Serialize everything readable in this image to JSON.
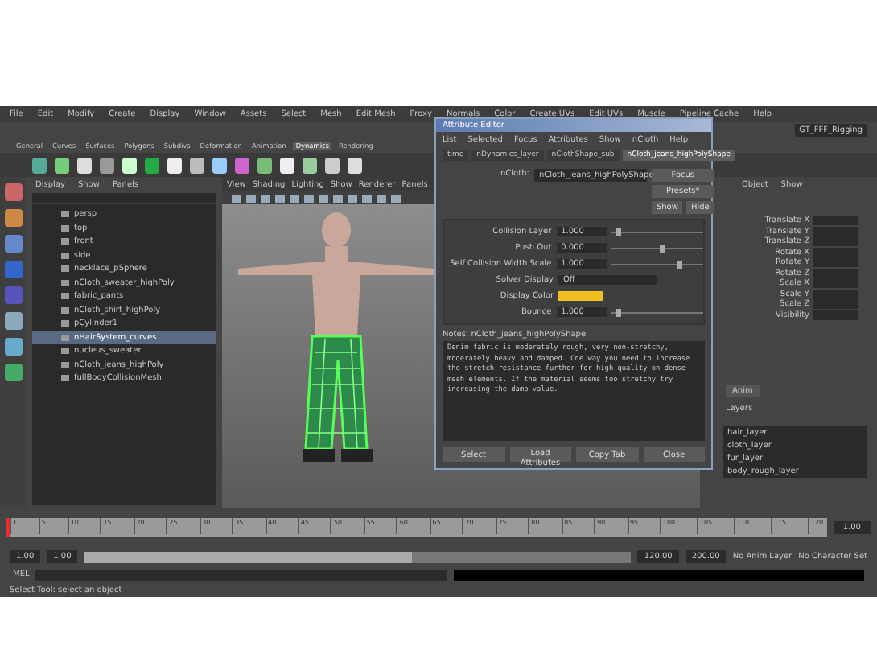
{
  "window": {
    "menus": [
      "File",
      "Edit",
      "Modify",
      "Create",
      "Display",
      "Window",
      "Assets",
      "Select",
      "Mesh",
      "Edit Mesh",
      "Proxy",
      "Normals",
      "Color",
      "Create UVs",
      "Edit UVs",
      "Muscle",
      "Pipeline Cache",
      "Help"
    ],
    "workspace": "GT_FFF_Rigging"
  },
  "shelf": {
    "tabs": [
      {
        "label": "General",
        "selected": false
      },
      {
        "label": "Curves",
        "selected": false
      },
      {
        "label": "Surfaces",
        "selected": false
      },
      {
        "label": "Polygons",
        "selected": false
      },
      {
        "label": "Subdivs",
        "selected": false
      },
      {
        "label": "Deformation",
        "selected": false
      },
      {
        "label": "Animation",
        "selected": false
      },
      {
        "label": "Dynamics",
        "selected": true
      },
      {
        "label": "Rendering",
        "selected": false
      }
    ]
  },
  "outliner": {
    "menus": [
      "Display",
      "Show",
      "Panels"
    ],
    "items": [
      {
        "label": "persp",
        "selected": false
      },
      {
        "label": "top",
        "selected": false
      },
      {
        "label": "front",
        "selected": false
      },
      {
        "label": "side",
        "selected": false
      },
      {
        "label": "necklace_pSphere",
        "selected": false
      },
      {
        "label": "nCloth_sweater_highPoly",
        "selected": false
      },
      {
        "label": "fabric_pants",
        "selected": false
      },
      {
        "label": "nCloth_shirt_highPoly",
        "selected": false
      },
      {
        "label": "pCylinder1",
        "selected": false
      },
      {
        "label": "nHairSystem_curves",
        "selected": true
      },
      {
        "label": "nucleus_sweater",
        "selected": false
      },
      {
        "label": "nCloth_jeans_highPoly",
        "selected": false
      },
      {
        "label": "fullBodyCollisionMesh",
        "selected": false
      }
    ]
  },
  "viewport": {
    "menus": [
      "View",
      "Shading",
      "Lighting",
      "Show",
      "Renderer",
      "Panels"
    ]
  },
  "attribute_editor": {
    "title": "Attribute Editor",
    "menus": [
      "List",
      "Selected",
      "Focus",
      "Attributes",
      "Show",
      "nCloth",
      "Help"
    ],
    "tabs": [
      {
        "label": "time",
        "selected": false
      },
      {
        "label": "nDynamics_layer",
        "selected": false
      },
      {
        "label": "nClothShape_sub",
        "selected": false
      },
      {
        "label": "nCloth_jeans_highPolyShape",
        "selected": true
      }
    ],
    "node_label": "nCloth:",
    "node_value": "nCloth_jeans_highPolyShape",
    "side_buttons": [
      "Focus",
      "Presets*",
      "Show",
      "Hide"
    ],
    "attributes": [
      {
        "kind": "number",
        "label": "Collision Layer",
        "value": "1.000",
        "level": 0.05
      },
      {
        "kind": "number",
        "label": "Push Out",
        "value": "0.000",
        "level": 0.55
      },
      {
        "kind": "number",
        "label": "Self Collision Width Scale",
        "value": "1.000",
        "level": 0.75
      },
      {
        "kind": "dropdown",
        "label": "Solver Display",
        "value": "Off"
      },
      {
        "kind": "color",
        "label": "Display Color",
        "color": "#f0c020"
      },
      {
        "kind": "number",
        "label": "Bounce",
        "value": "1.000",
        "level": 0.05
      }
    ],
    "notes_label": "Notes: nCloth_jeans_highPolyShape",
    "notes": "Denim fabric is moderately rough, very non-stretchy, moderately heavy and damped. One way you need to increase the stretch resistance further for high quality on dense mesh elements. If the material seems too stretchy try increasing the damp value.",
    "buttons": [
      "Select",
      "Load Attributes",
      "Copy Tab",
      "Close"
    ]
  },
  "channel_box": {
    "menus": [
      "Object",
      "Show"
    ],
    "channels": [
      "Translate X",
      "Translate Y",
      "Translate Z",
      "Rotate X",
      "Rotate Y",
      "Rotate Z",
      "Scale X",
      "Scale Y",
      "Scale Z",
      "Visibility"
    ],
    "layer_tab": "Anim",
    "layer_menu": "Layers",
    "layers": [
      "hair_layer",
      "cloth_layer",
      "fur_layer",
      "body_rough_layer"
    ]
  },
  "timeline": {
    "ticks": [
      "1",
      "5",
      "10",
      "15",
      "20",
      "25",
      "30",
      "35",
      "40",
      "45",
      "50",
      "55",
      "60",
      "65",
      "70",
      "75",
      "80",
      "85",
      "90",
      "95",
      "100",
      "105",
      "110",
      "115",
      "120"
    ],
    "current": "1.00",
    "level": 0
  },
  "range": {
    "start": "1.00",
    "inner_start": "1.00",
    "inner_end": "120.00",
    "end": "200.00",
    "level": 0.6,
    "anim_layer": "No Anim Layer",
    "character_set": "No Character Set"
  },
  "command_line": {
    "label": "MEL"
  },
  "help_line": "Select Tool: select an object"
}
